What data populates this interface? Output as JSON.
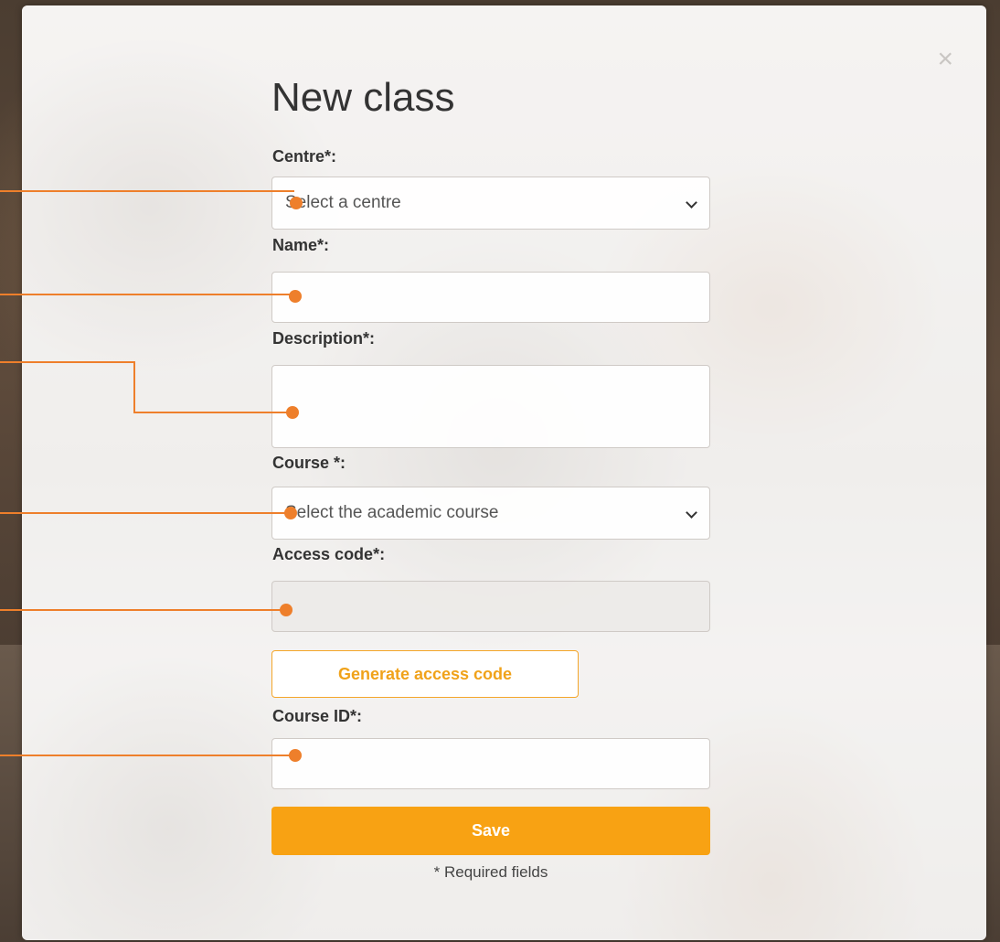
{
  "modal": {
    "title": "New class",
    "close_glyph": "×",
    "accent_color": "#f8a213"
  },
  "form": {
    "centre": {
      "label": "Centre*:",
      "value": "Select a centre"
    },
    "name": {
      "label": "Name*:",
      "value": ""
    },
    "description": {
      "label": "Description*:",
      "value": ""
    },
    "course": {
      "label": "Course *:",
      "value": "Select the academic course"
    },
    "access_code": {
      "label": "Access code*:",
      "value": ""
    },
    "generate_label": "Generate access code",
    "course_id": {
      "label": "Course ID*:",
      "value": ""
    },
    "save_label": "Save",
    "required_note": "* Required fields"
  },
  "callouts": {
    "color": "#ee7f2b"
  }
}
